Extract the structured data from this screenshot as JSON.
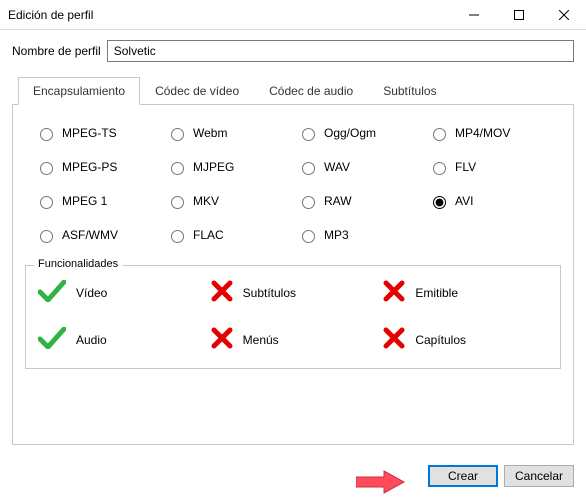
{
  "window": {
    "title": "Edición de perfil"
  },
  "profile": {
    "name_label": "Nombre de perfil",
    "name_value": "Solvetic"
  },
  "tabs": {
    "encapsulation": "Encapsulamiento",
    "video_codec": "Códec de vídeo",
    "audio_codec": "Códec de audio",
    "subtitles": "Subtítulos"
  },
  "formats": {
    "selected": "AVI",
    "items": [
      "MPEG-TS",
      "Webm",
      "Ogg/Ogm",
      "MP4/MOV",
      "MPEG-PS",
      "MJPEG",
      "WAV",
      "FLV",
      "MPEG 1",
      "MKV",
      "RAW",
      "AVI",
      "ASF/WMV",
      "FLAC",
      "MP3"
    ]
  },
  "features": {
    "title": "Funcionalidades",
    "items": [
      {
        "label": "Vídeo",
        "ok": true
      },
      {
        "label": "Subtítulos",
        "ok": false
      },
      {
        "label": "Emitible",
        "ok": false
      },
      {
        "label": "Audio",
        "ok": true
      },
      {
        "label": "Menús",
        "ok": false
      },
      {
        "label": "Capítulos",
        "ok": false
      }
    ]
  },
  "buttons": {
    "create": "Crear",
    "cancel": "Cancelar"
  }
}
